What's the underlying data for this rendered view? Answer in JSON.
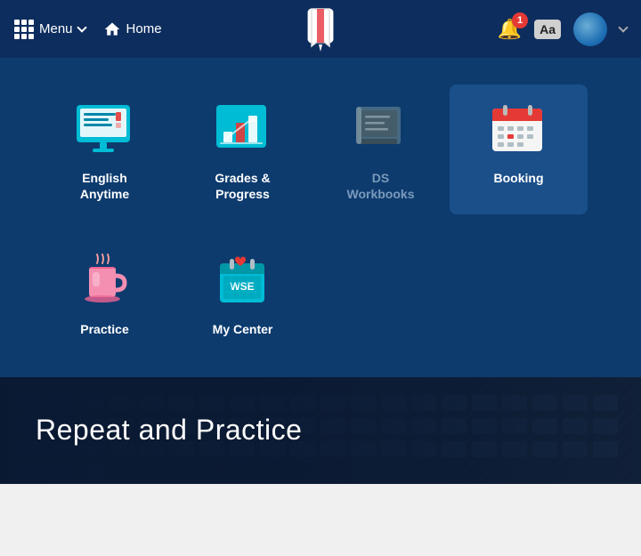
{
  "navbar": {
    "menu_label": "Menu",
    "home_label": "Home",
    "notif_count": "1",
    "font_btn_label": "Aa"
  },
  "menu_items": {
    "row1": [
      {
        "id": "english-anytime",
        "label": "English\nAnytime",
        "active": false,
        "dimmed": false
      },
      {
        "id": "grades-progress",
        "label": "Grades &\nProgress",
        "active": false,
        "dimmed": false
      },
      {
        "id": "ds-workbooks",
        "label": "DS\nWorkbooks",
        "active": false,
        "dimmed": true
      },
      {
        "id": "booking",
        "label": "Booking",
        "active": true,
        "dimmed": false
      }
    ],
    "row2": [
      {
        "id": "practice",
        "label": "Practice",
        "active": false,
        "dimmed": false
      },
      {
        "id": "my-center",
        "label": "My Center",
        "active": false,
        "dimmed": false
      }
    ]
  },
  "bottom": {
    "text": "Repeat and Practice"
  }
}
